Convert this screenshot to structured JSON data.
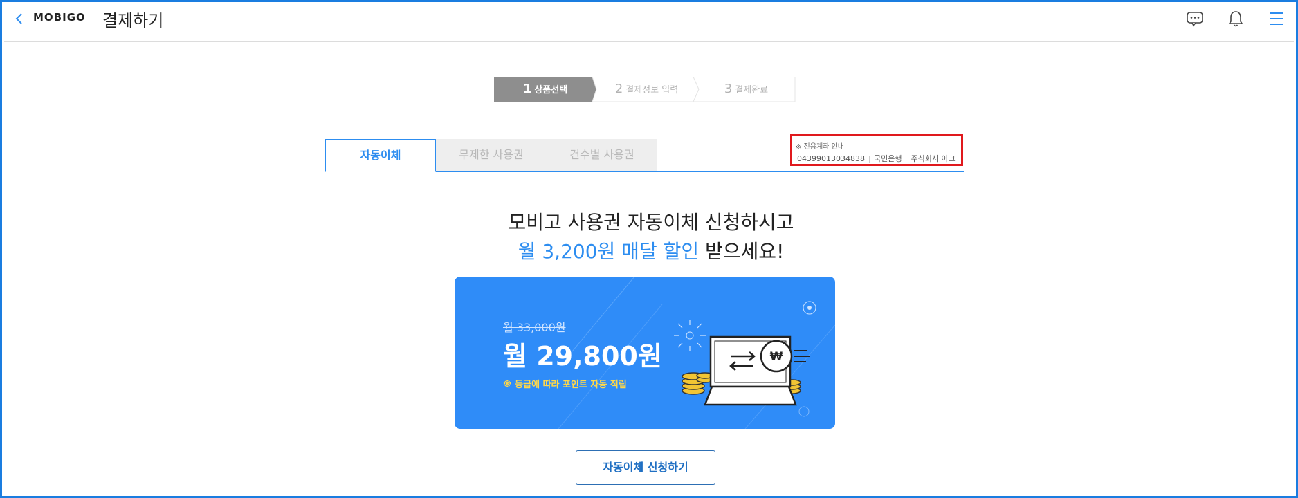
{
  "header": {
    "brand": "MOBIGO",
    "title": "결제하기",
    "icons": [
      "back-icon",
      "chat-icon",
      "bell-icon",
      "menu-icon"
    ]
  },
  "steps": [
    {
      "num": "1",
      "label": "상품선택",
      "state": "active"
    },
    {
      "num": "2",
      "label": "결제정보 입력",
      "state": "inactive"
    },
    {
      "num": "3",
      "label": "결제완료",
      "state": "inactive"
    }
  ],
  "tabs": [
    {
      "label": "자동이체",
      "active": true
    },
    {
      "label": "무제한 사용권",
      "active": false
    },
    {
      "label": "건수별 사용권",
      "active": false
    }
  ],
  "account": {
    "note": "※ 전용계좌 안내",
    "number": "04399013034838",
    "bank": "국민은행",
    "holder": "주식회사 아크"
  },
  "headline": {
    "line1": "모비고 사용권 자동이체 신청하시고",
    "line2_highlight": "월 3,200원 매달 할인",
    "line2_rest": " 받으세요!"
  },
  "promo": {
    "old_price": "월 33,000원",
    "new_price": "월 29,800원",
    "note": "※ 등급에 따라 포인트 자동 적립",
    "won_symbol": "₩"
  },
  "cta": {
    "label": "자동이체 신청하기"
  },
  "colors": {
    "accent": "#2d8df0",
    "promo_bg": "#2f8cf8",
    "highlight_box": "#e0191d",
    "frame": "#1a7de0"
  }
}
